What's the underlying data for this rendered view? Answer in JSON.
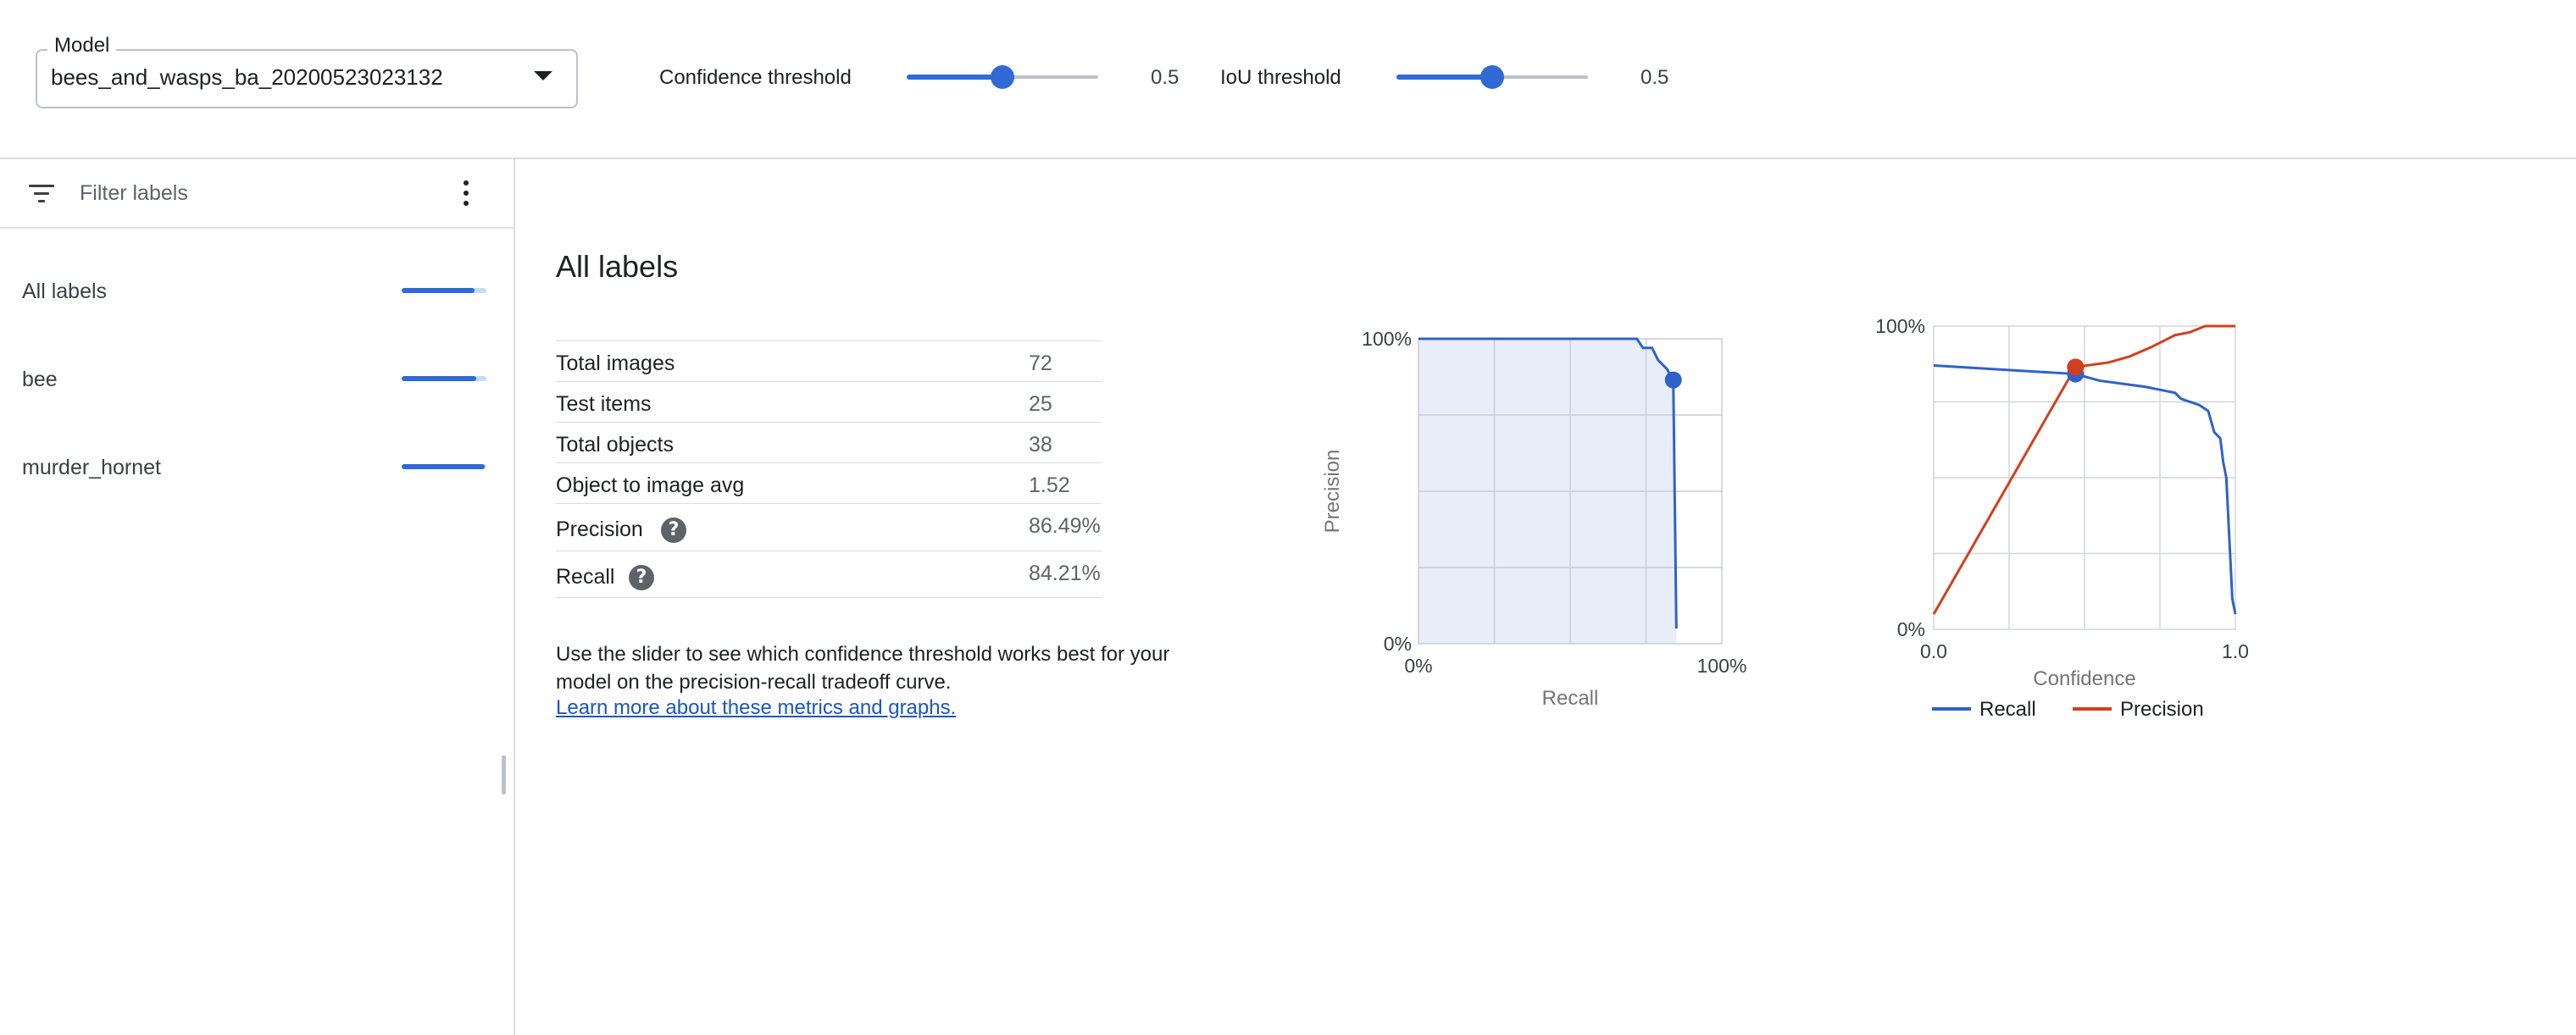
{
  "top_bar": {
    "model": {
      "label": "Model",
      "value": "bees_and_wasps_ba_20200523023132"
    },
    "confidence_threshold": {
      "label": "Confidence threshold",
      "value": 0.5,
      "display": "0.5"
    },
    "iou_threshold": {
      "label": "IoU threshold",
      "value": 0.5,
      "display": "0.5"
    }
  },
  "sidebar": {
    "filter_placeholder": "Filter labels",
    "labels": [
      {
        "name": "All labels",
        "score": 0.86
      },
      {
        "name": "bee",
        "score": 0.88
      },
      {
        "name": "murder_hornet",
        "score": 0.98
      }
    ]
  },
  "main": {
    "title": "All labels",
    "stats": [
      {
        "name": "Total images",
        "value": "72"
      },
      {
        "name": "Test items",
        "value": "25"
      },
      {
        "name": "Total objects",
        "value": "38"
      },
      {
        "name": "Object to image avg",
        "value": "1.52"
      },
      {
        "name": "Precision",
        "value": "86.49%",
        "help": "?"
      },
      {
        "name": "Recall",
        "value": "84.21%",
        "help": "?"
      }
    ],
    "note": "Use the slider to see which confidence threshold works best for your model on the precision-recall tradeoff curve.",
    "learn_link": "Learn more about these metrics and graphs."
  },
  "colors": {
    "accent": "#2f6ad6",
    "recall": "#2f62c9",
    "precision": "#d23f1f",
    "pr_area": "#e8eef9"
  },
  "chart_data": [
    {
      "type": "area",
      "title": "",
      "xlabel": "Recall",
      "ylabel": "Precision",
      "x_ticks": [
        "0%",
        "100%"
      ],
      "y_ticks": [
        "0%",
        "100%"
      ],
      "xlim": [
        0,
        1
      ],
      "ylim": [
        0,
        1
      ],
      "grid": true,
      "series": [
        {
          "x": [
            0.0,
            0.72,
            0.74,
            0.77,
            0.79,
            0.82,
            0.84,
            0.85
          ],
          "y": [
            1.0,
            1.0,
            0.97,
            0.97,
            0.93,
            0.9,
            0.86,
            0.05
          ]
        }
      ],
      "marker": {
        "x": 0.84,
        "y": 0.865
      }
    },
    {
      "type": "line",
      "title": "",
      "xlabel": "Confidence",
      "ylabel": "",
      "x_ticks": [
        "0.0",
        "1.0"
      ],
      "y_ticks": [
        "0%",
        "100%"
      ],
      "xlim": [
        0,
        1
      ],
      "ylim": [
        0,
        1
      ],
      "grid": true,
      "legend": "bottom",
      "series": [
        {
          "name": "Recall",
          "x": [
            0.0,
            0.47,
            0.55,
            0.7,
            0.8,
            0.82,
            0.88,
            0.91,
            0.93,
            0.95,
            0.96,
            0.97,
            0.98,
            0.99,
            1.0
          ],
          "y": [
            0.87,
            0.842,
            0.82,
            0.8,
            0.78,
            0.76,
            0.74,
            0.72,
            0.65,
            0.63,
            0.55,
            0.5,
            0.3,
            0.1,
            0.05
          ]
        },
        {
          "name": "Precision",
          "x": [
            0.0,
            0.47,
            0.58,
            0.65,
            0.72,
            0.78,
            0.8,
            0.85,
            0.9,
            1.0
          ],
          "y": [
            0.05,
            0.865,
            0.88,
            0.9,
            0.93,
            0.96,
            0.97,
            0.98,
            1.0,
            1.0
          ]
        }
      ],
      "markers": [
        {
          "series": "Recall",
          "x": 0.47,
          "y": 0.842
        },
        {
          "series": "Precision",
          "x": 0.47,
          "y": 0.865
        }
      ]
    }
  ]
}
